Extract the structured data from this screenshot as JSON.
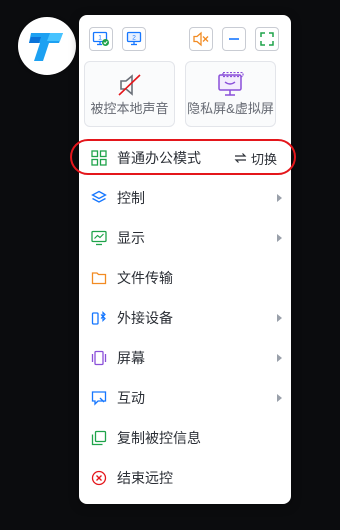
{
  "logo": {
    "icon": "app-logo-icon"
  },
  "toolbar": {
    "screen1_label": "1",
    "screen2_label": "2"
  },
  "tiles": {
    "mute_local": "被控本地声音",
    "privacy_screen": "隐私屏&虚拟屏"
  },
  "menu": {
    "office_mode": "普通办公模式",
    "switch_label": "切换",
    "items": [
      {
        "label": "控制",
        "icon": "layers-icon",
        "submenu": true
      },
      {
        "label": "显示",
        "icon": "monitor-chart-icon",
        "submenu": true
      },
      {
        "label": "文件传输",
        "icon": "folder-icon",
        "submenu": false
      },
      {
        "label": "外接设备",
        "icon": "devices-bluetooth-icon",
        "submenu": true
      },
      {
        "label": "屏幕",
        "icon": "screen-icon",
        "submenu": true
      },
      {
        "label": "互动",
        "icon": "chat-screen-icon",
        "submenu": true
      },
      {
        "label": "复制被控信息",
        "icon": "copy-icon",
        "submenu": false
      },
      {
        "label": "结束远控",
        "icon": "close-circle-icon",
        "submenu": false
      }
    ]
  },
  "colors": {
    "accent_blue": "#1677ff",
    "orange": "#f28b22",
    "green": "#1fa34a",
    "purple": "#8a4fd9",
    "red": "#e4161b"
  }
}
